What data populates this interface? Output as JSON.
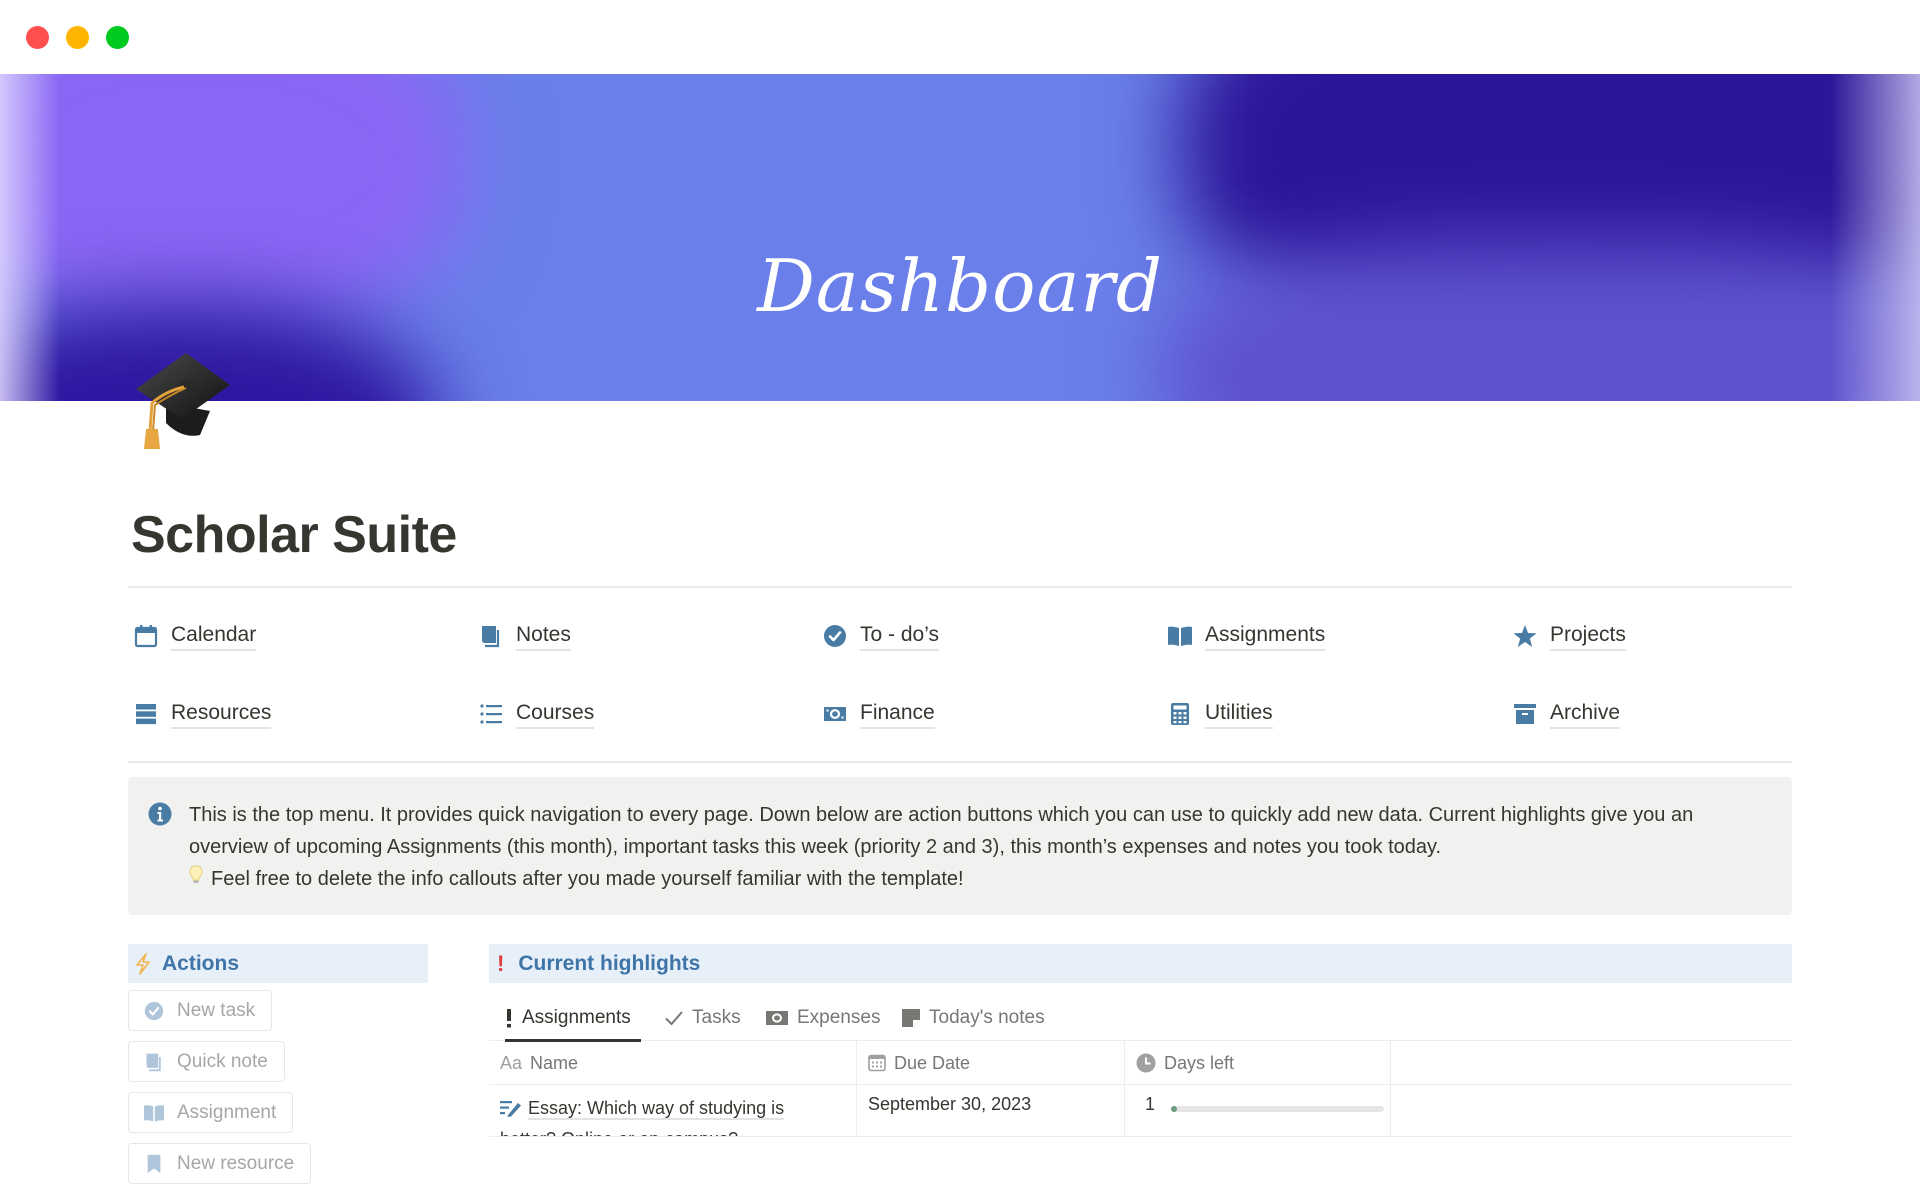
{
  "window": {
    "controls": [
      "close",
      "minimize",
      "zoom"
    ]
  },
  "banner": {
    "title": "Dashboard",
    "colors": {
      "light": "#6A7FEA",
      "violet": "#8B66F4",
      "deep": "#2C1597",
      "mid": "#5E52CE"
    }
  },
  "page": {
    "icon": "graduation-cap-emoji",
    "title": "Scholar Suite"
  },
  "nav": {
    "accent": "#487CA5",
    "items": [
      {
        "label": "Calendar",
        "icon": "calendar-icon"
      },
      {
        "label": "Notes",
        "icon": "notes-icon"
      },
      {
        "label": "To - do’s",
        "icon": "check-circle-icon"
      },
      {
        "label": "Assignments",
        "icon": "open-book-icon"
      },
      {
        "label": "Projects",
        "icon": "star-icon"
      },
      {
        "label": "Resources",
        "icon": "stack-icon"
      },
      {
        "label": "Courses",
        "icon": "list-icon"
      },
      {
        "label": "Finance",
        "icon": "money-icon"
      },
      {
        "label": "Utilities",
        "icon": "calculator-icon"
      },
      {
        "label": "Archive",
        "icon": "archive-icon"
      }
    ]
  },
  "callout": {
    "icon": "info-icon",
    "line1": "This is the top menu. It provides quick navigation to every page. Down below are action buttons which you can use to quickly add new data. Current highlights give you an overview of upcoming Assignments (this month), important tasks this week (priority 2 and 3), this month’s expenses and notes you took today.",
    "line2": "Feel free to delete the info callouts after you made yourself familiar with the template!"
  },
  "actions": {
    "title": "Actions",
    "buttons": [
      {
        "label": "New task",
        "icon": "check-circle-icon"
      },
      {
        "label": "Quick note",
        "icon": "notes-icon"
      },
      {
        "label": "Assignment",
        "icon": "open-book-icon"
      },
      {
        "label": "New resource",
        "icon": "bookmark-icon"
      }
    ]
  },
  "highlights": {
    "title": "Current highlights",
    "tabs": [
      {
        "label": "Assignments",
        "icon": "exclamation-icon",
        "active": true
      },
      {
        "label": "Tasks",
        "icon": "checkmark-icon",
        "active": false
      },
      {
        "label": "Expenses",
        "icon": "money-icon",
        "active": false
      },
      {
        "label": "Today's notes",
        "icon": "note-icon",
        "active": false
      }
    ],
    "table": {
      "columns": [
        {
          "label": "Name",
          "icon": "text-aa-icon"
        },
        {
          "label": "Due Date",
          "icon": "calendar-icon"
        },
        {
          "label": "Days left",
          "icon": "clock-icon"
        }
      ],
      "rows": [
        {
          "name": "Essay: Which way of studying is better? Online or on-campus?",
          "due_date": "September 30, 2023",
          "days_left": "1",
          "days_left_progress": 0.02
        }
      ]
    }
  }
}
